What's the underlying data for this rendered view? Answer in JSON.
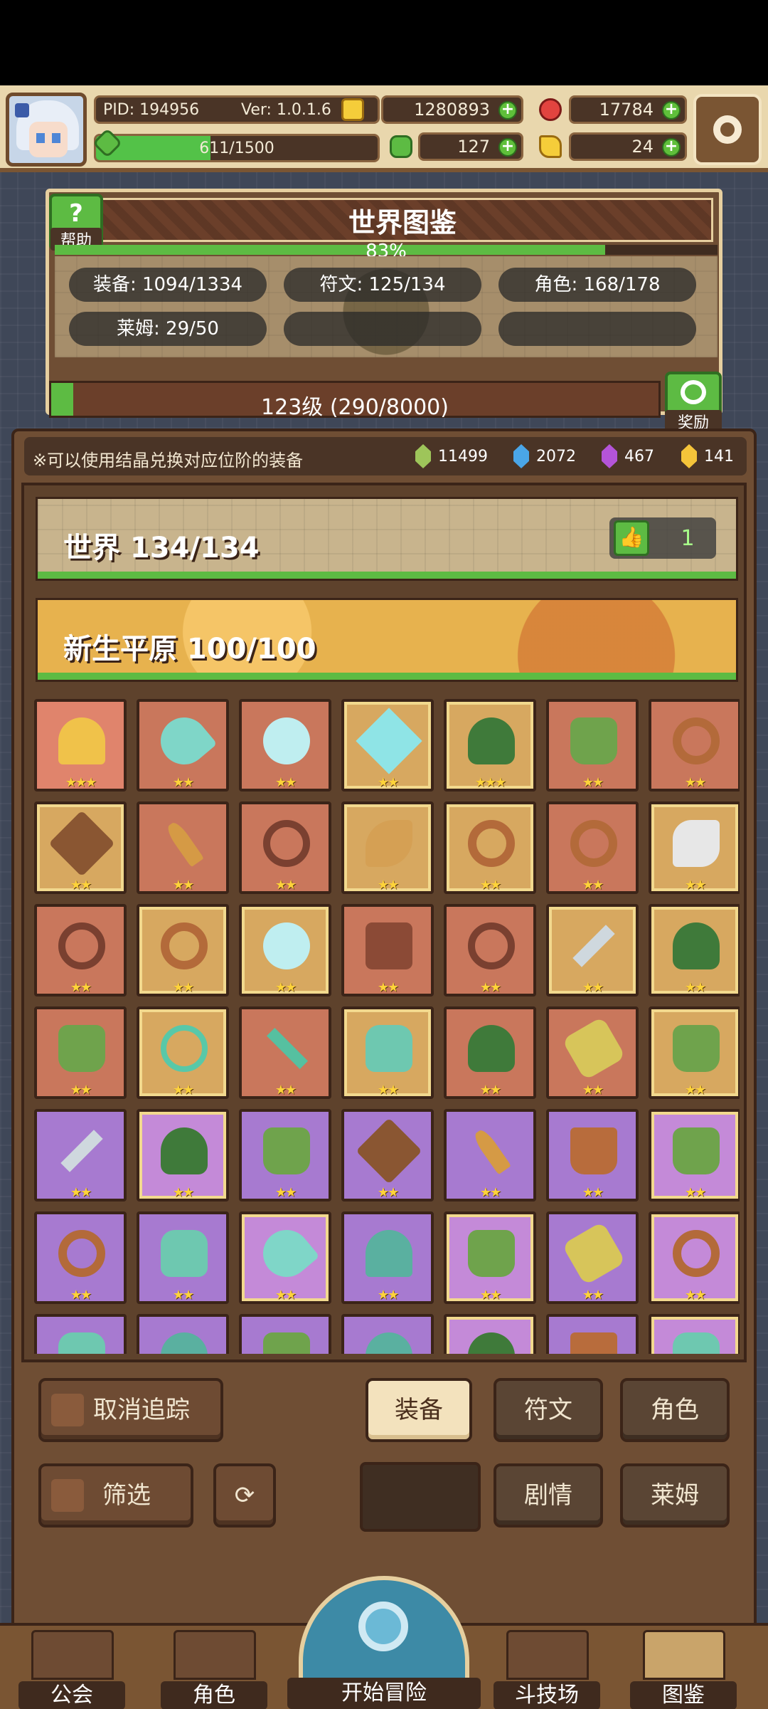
{
  "topbar": {
    "pid": "PID: 194956",
    "version": "Ver: 1.0.1.6",
    "exp": "611/1500",
    "exp_fraction": 0.407,
    "gold": "1280893",
    "ruby": "17784",
    "clover": "127",
    "key": "24"
  },
  "world": {
    "title": "世界图鉴",
    "help_label": "帮助",
    "percent": "83%",
    "percent_value": 0.83,
    "stats": [
      "装备: 1094/1334",
      "符文: 125/134",
      "角色: 168/178",
      "莱姆: 29/50"
    ],
    "level": "123级 (290/8000)",
    "level_fraction": 0.036,
    "reward_label": "奖励"
  },
  "crystals": {
    "note": "※可以使用结晶兑换对应位阶的装备",
    "green": "11499",
    "blue": "2072",
    "purple": "467",
    "gold": "141"
  },
  "banners": {
    "world": "世界  134/134",
    "like_count": "1",
    "region": "新生平原  100/100"
  },
  "grid": {
    "stars": "★★★",
    "stars2": "★★",
    "rows": [
      [
        {
          "bg": "#e0846c",
          "icon": "straw-hat",
          "stars": 3
        },
        {
          "bg": "#c9775c",
          "icon": "mace",
          "stars": 2
        },
        {
          "bg": "#c9775c",
          "icon": "orb",
          "stars": 2
        },
        {
          "bg": "#d7a860",
          "icon": "diamond",
          "stars": 2
        },
        {
          "bg": "#d7a860",
          "icon": "hood",
          "stars": 3
        },
        {
          "bg": "#c9775c",
          "icon": "armor",
          "stars": 2
        },
        {
          "bg": "#c9775c",
          "icon": "ring",
          "stars": 2
        }
      ],
      [
        {
          "bg": "#d7a860",
          "icon": "crossbow",
          "stars": 2
        },
        {
          "bg": "#c9775c",
          "icon": "spear",
          "stars": 2
        },
        {
          "bg": "#c9775c",
          "icon": "necklace",
          "stars": 2
        },
        {
          "bg": "#d7a860",
          "icon": "horn",
          "stars": 2
        },
        {
          "bg": "#d7a860",
          "icon": "ring",
          "stars": 2
        },
        {
          "bg": "#c9775c",
          "icon": "ring",
          "stars": 2
        },
        {
          "bg": "#d7a860",
          "icon": "axe",
          "stars": 2
        }
      ],
      [
        {
          "bg": "#c9775c",
          "icon": "necklace",
          "stars": 2
        },
        {
          "bg": "#d7a860",
          "icon": "ring",
          "stars": 2
        },
        {
          "bg": "#d7a860",
          "icon": "orb",
          "stars": 2
        },
        {
          "bg": "#c9775c",
          "icon": "bracer",
          "stars": 2
        },
        {
          "bg": "#c9775c",
          "icon": "necklace",
          "stars": 2
        },
        {
          "bg": "#d7a860",
          "icon": "sword",
          "stars": 2
        },
        {
          "bg": "#d7a860",
          "icon": "hood",
          "stars": 2
        }
      ],
      [
        {
          "bg": "#c9775c",
          "icon": "armor",
          "stars": 2
        },
        {
          "bg": "#d7a860",
          "icon": "bow",
          "stars": 2
        },
        {
          "bg": "#c9775c",
          "icon": "arrow",
          "stars": 2
        },
        {
          "bg": "#d7a860",
          "icon": "boots",
          "stars": 2
        },
        {
          "bg": "#c9775c",
          "icon": "hood",
          "stars": 2
        },
        {
          "bg": "#c9775c",
          "icon": "glove",
          "stars": 2
        },
        {
          "bg": "#d7a860",
          "icon": "armor",
          "stars": 2
        }
      ],
      [
        {
          "bg": "#a77ad0",
          "icon": "sword",
          "stars": 2
        },
        {
          "bg": "#c48ad8",
          "icon": "hood",
          "stars": 2
        },
        {
          "bg": "#a77ad0",
          "icon": "armor",
          "stars": 2
        },
        {
          "bg": "#a77ad0",
          "icon": "crossbow",
          "stars": 2
        },
        {
          "bg": "#a77ad0",
          "icon": "spear",
          "stars": 2
        },
        {
          "bg": "#a77ad0",
          "icon": "pants",
          "stars": 2
        },
        {
          "bg": "#c48ad8",
          "icon": "armor",
          "stars": 2
        }
      ],
      [
        {
          "bg": "#a77ad0",
          "icon": "ring",
          "stars": 2
        },
        {
          "bg": "#a77ad0",
          "icon": "boots",
          "stars": 2
        },
        {
          "bg": "#c48ad8",
          "icon": "mace",
          "stars": 2
        },
        {
          "bg": "#a77ad0",
          "icon": "hat",
          "stars": 2
        },
        {
          "bg": "#c48ad8",
          "icon": "armor",
          "stars": 2
        },
        {
          "bg": "#a77ad0",
          "icon": "glove",
          "stars": 2
        },
        {
          "bg": "#c48ad8",
          "icon": "ring",
          "stars": 2
        }
      ],
      [
        {
          "bg": "#a77ad0",
          "icon": "boots",
          "stars": 0
        },
        {
          "bg": "#a77ad0",
          "icon": "hat",
          "stars": 0
        },
        {
          "bg": "#a77ad0",
          "icon": "armor",
          "stars": 0
        },
        {
          "bg": "#a77ad0",
          "icon": "hat",
          "stars": 0
        },
        {
          "bg": "#c48ad8",
          "icon": "hood",
          "stars": 0
        },
        {
          "bg": "#a77ad0",
          "icon": "pants",
          "stars": 0
        },
        {
          "bg": "#c48ad8",
          "icon": "boots",
          "stars": 0
        }
      ]
    ]
  },
  "controls": {
    "untrack": "取消追踪",
    "filter": "筛选",
    "tab_equipment": "装备",
    "tab_rune": "符文",
    "tab_character": "角色",
    "tab_story": "剧情",
    "tab_slime": "莱姆"
  },
  "nav": {
    "guild": "公会",
    "character": "角色",
    "adventure": "开始冒险",
    "arena": "斗技场",
    "codex": "图鉴"
  },
  "colors": {
    "accent_green": "#5dbb43",
    "panel_brown": "#6f4e34",
    "dark_brown": "#3b2418",
    "frame_cream": "#e6cf9f"
  }
}
